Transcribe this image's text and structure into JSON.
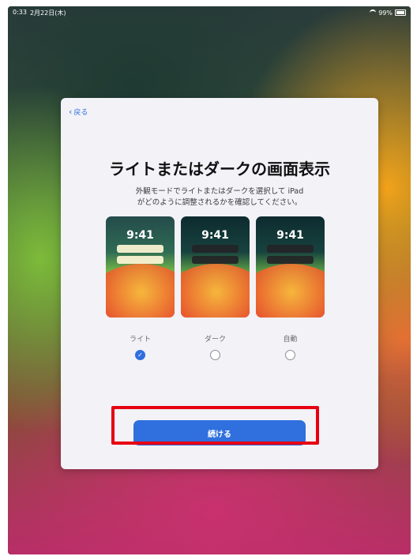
{
  "status": {
    "time": "0:33",
    "date": "2月22日(木)",
    "battery": "99%"
  },
  "nav": {
    "back_label": "戻る"
  },
  "main": {
    "title": "ライトまたはダークの画面表示",
    "subtitle_line1": "外観モードでライトまたはダークを選択して iPad",
    "subtitle_line2": "がどのように調整されるかを確認してください。"
  },
  "previews": [
    {
      "clock": "9:41",
      "label": "ライト",
      "selected": true
    },
    {
      "clock": "9:41",
      "label": "ダーク",
      "selected": false
    },
    {
      "clock": "9:41",
      "label": "自動",
      "selected": false
    }
  ],
  "actions": {
    "continue_label": "続ける"
  },
  "colors": {
    "accent": "#2f6fde",
    "highlight": "#e60012"
  }
}
